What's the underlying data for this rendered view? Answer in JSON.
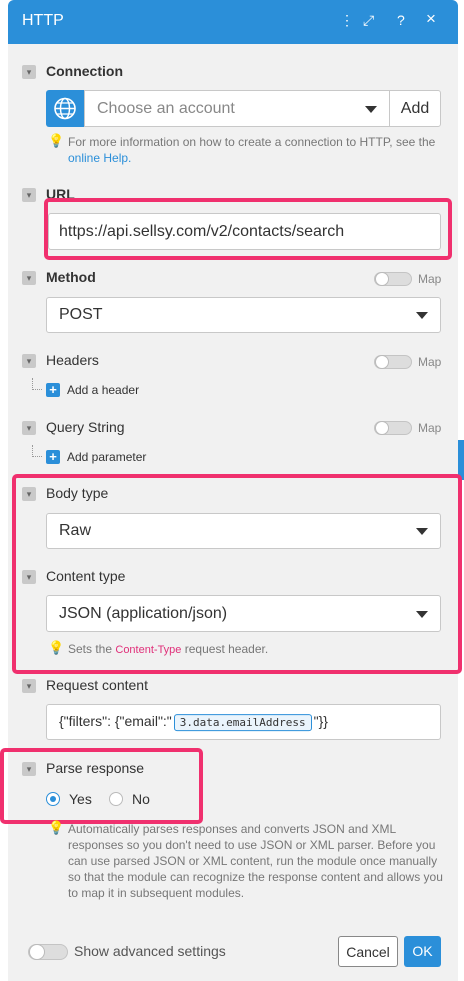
{
  "header": {
    "title": "HTTP",
    "icons": [
      "more-vertical-icon",
      "expand-icon",
      "help-icon",
      "close-icon"
    ],
    "more_glyph": "⋮",
    "expand_glyph": "⤢",
    "help_glyph": "?",
    "close_glyph": "×"
  },
  "connection": {
    "label": "Connection",
    "placeholder": "Choose an account",
    "add_label": "Add",
    "hint_prefix": "For more information on how to create a connection to HTTP, see the",
    "hint_link": "online Help."
  },
  "url": {
    "label": "URL",
    "value": "https://api.sellsy.com/v2/contacts/search"
  },
  "method": {
    "label": "Method",
    "value": "POST",
    "map_label": "Map"
  },
  "headers": {
    "label": "Headers",
    "map_label": "Map",
    "add_label": "Add a header"
  },
  "query": {
    "label": "Query String",
    "map_label": "Map",
    "add_label": "Add parameter"
  },
  "body_type": {
    "label": "Body type",
    "value": "Raw"
  },
  "content_type": {
    "label": "Content type",
    "value": "JSON (application/json)",
    "hint_prefix": "Sets the",
    "hint_code": "Content-Type",
    "hint_suffix": "request header."
  },
  "request_content": {
    "label": "Request content",
    "prefix": "{\"filters\": {\"email\":\"",
    "pill": "3.data.emailAddress",
    "suffix": "\"}}"
  },
  "parse_response": {
    "label": "Parse response",
    "yes": "Yes",
    "no": "No",
    "selected": "Yes",
    "hint": "Automatically parses responses and converts JSON and XML responses so you don't need to use JSON or XML parser. Before you can use parsed JSON or XML content, run the module once manually so that the module can recognize the response content and allows you to map it in subsequent modules."
  },
  "footer": {
    "advanced_label": "Show advanced settings",
    "cancel_label": "Cancel",
    "ok_label": "OK"
  },
  "colors": {
    "accent": "#2b8fd9",
    "highlight": "#f0306e"
  }
}
